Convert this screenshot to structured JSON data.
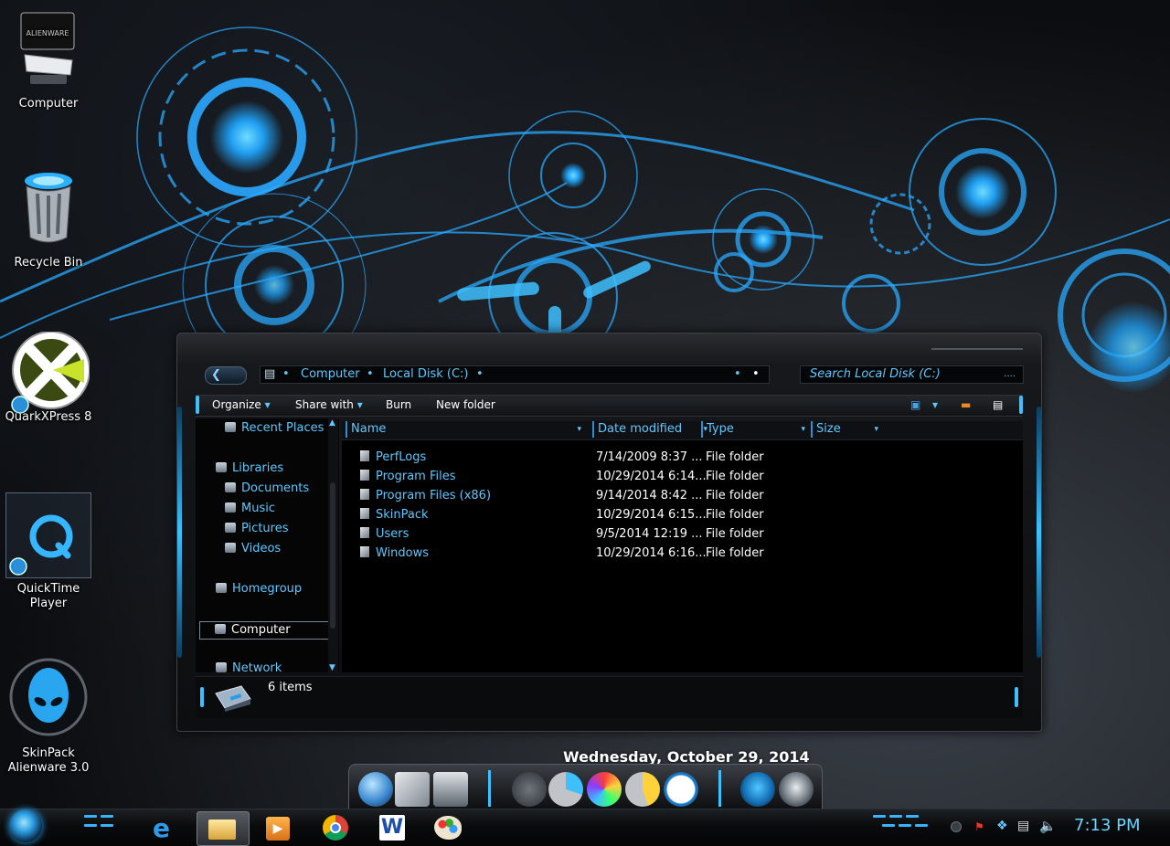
{
  "desktop": {
    "icons": [
      {
        "label": "Computer"
      },
      {
        "label": "Recycle Bin"
      },
      {
        "label": "QuarkXPress 8"
      },
      {
        "label": "QuickTime\nPlayer",
        "line1": "QuickTime",
        "line2": "Player"
      },
      {
        "label": "SkinPack\nAlienware 3.0",
        "line1": "SkinPack",
        "line2": "Alienware 3.0"
      }
    ],
    "computer_logo_text": "ALIENWARE"
  },
  "explorer": {
    "breadcrumb": [
      "Computer",
      "Local Disk (C:)"
    ],
    "search_placeholder": "Search Local Disk (C:)",
    "search_ellipsis": "....",
    "commands": {
      "organize": "Organize",
      "share_with": "Share with",
      "burn": "Burn",
      "new_folder": "New folder"
    },
    "nav": {
      "recent_places": "Recent Places",
      "libraries": "Libraries",
      "documents": "Documents",
      "music": "Music",
      "pictures": "Pictures",
      "videos": "Videos",
      "homegroup": "Homegroup",
      "computer": "Computer",
      "network": "Network"
    },
    "columns": {
      "name": "Name",
      "date": "Date modified",
      "type": "Type",
      "size": "Size"
    },
    "files": [
      {
        "name": "PerfLogs",
        "date": "7/14/2009 8:37 ...",
        "type": "File folder"
      },
      {
        "name": "Program Files",
        "date": "10/29/2014 6:14...",
        "type": "File folder"
      },
      {
        "name": "Program Files (x86)",
        "date": "9/14/2014 8:42 ...",
        "type": "File folder"
      },
      {
        "name": "SkinPack",
        "date": "10/29/2014 6:15...",
        "type": "File folder"
      },
      {
        "name": "Users",
        "date": "9/5/2014 12:19 ...",
        "type": "File folder"
      },
      {
        "name": "Windows",
        "date": "10/29/2014 6:16...",
        "type": "File folder"
      }
    ],
    "item_count": "6 items"
  },
  "gadget": {
    "date": "Wednesday, October 29, 2014"
  },
  "taskbar": {
    "clock": "7:13 PM",
    "apps": [
      "internet-explorer",
      "windows-explorer",
      "media-player",
      "chrome",
      "word",
      "paint"
    ]
  },
  "colors": {
    "accent": "#3ec0ff",
    "text_link": "#5fc8ff"
  }
}
